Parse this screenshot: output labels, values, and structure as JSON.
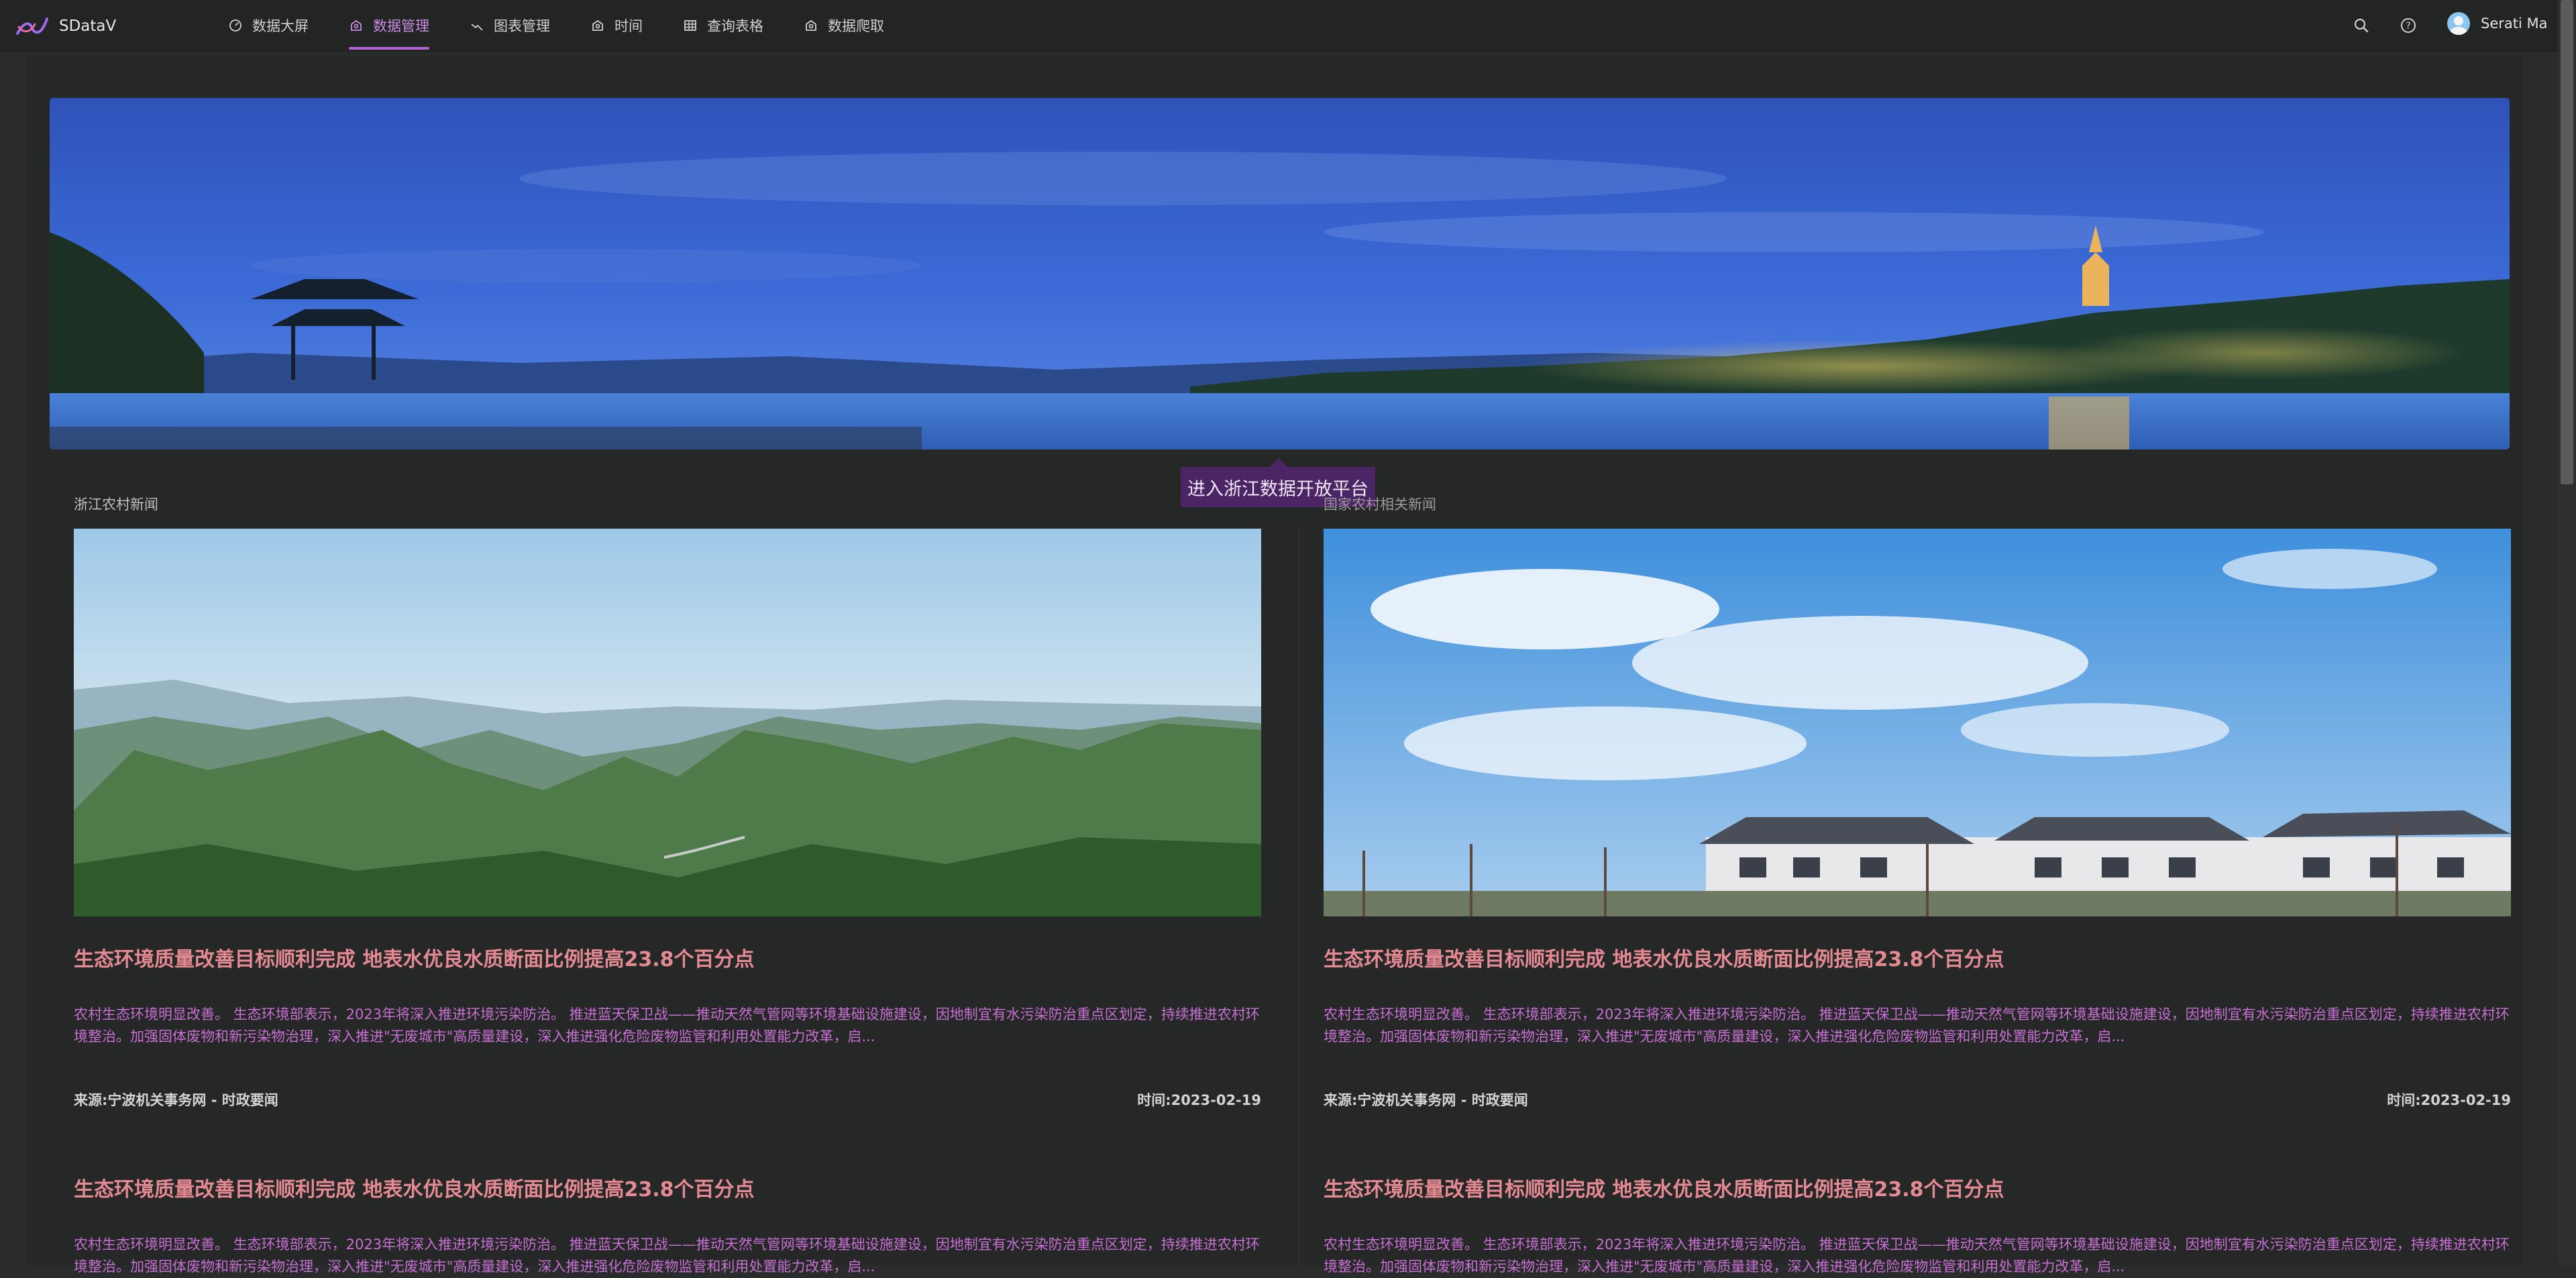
{
  "app": {
    "brand": "SDataV"
  },
  "nav": {
    "items": [
      {
        "label": "数据大屏",
        "icon": "dashboard-icon"
      },
      {
        "label": "数据管理",
        "icon": "data-manage-icon",
        "active": true
      },
      {
        "label": "图表管理",
        "icon": "chart-manage-icon"
      },
      {
        "label": "时间",
        "icon": "time-icon"
      },
      {
        "label": "查询表格",
        "icon": "table-icon"
      },
      {
        "label": "数据爬取",
        "icon": "crawler-icon"
      }
    ],
    "tools": [
      "search-icon",
      "help-icon"
    ],
    "user": "Serati Ma"
  },
  "banner": {
    "tooltip": "进入浙江数据开放平台"
  },
  "columns": [
    {
      "label": "浙江农村新闻",
      "image": "mountain-landscape-image",
      "articles": [
        {
          "title": "生态环境质量改善目标顺利完成 地表水优良水质断面比例提高23.8个百分点",
          "summary": "农村生态环境明显改善。 生态环境部表示，2023年将深入推进环境污染防治。 推进蓝天保卫战——推动天然气管网等环境基础设施建设，因地制宜有水污染防治重点区划定，持续推进农村环境整治。加强固体废物和新污染物治理，深入推进\"无废城市\"高质量建设，深入推进强化危险废物监管和利用处置能力改革，启...",
          "source": "来源:宁波机关事务网  - 时政要闻",
          "time": "时间:2023-02-19"
        },
        {
          "title": "生态环境质量改善目标顺利完成 地表水优良水质断面比例提高23.8个百分点",
          "summary": "农村生态环境明显改善。 生态环境部表示，2023年将深入推进环境污染防治。 推进蓝天保卫战——推动天然气管网等环境基础设施建设，因地制宜有水污染防治重点区划定，持续推进农村环境整治。加强固体废物和新污染物治理，深入推进\"无废城市\"高质量建设，深入推进强化危险废物监管和利用处置能力改革，启..."
        }
      ]
    },
    {
      "label": "国家农村相关新闻",
      "image": "village-houses-sky-image",
      "articles": [
        {
          "title": "生态环境质量改善目标顺利完成 地表水优良水质断面比例提高23.8个百分点",
          "summary": "农村生态环境明显改善。 生态环境部表示，2023年将深入推进环境污染防治。 推进蓝天保卫战——推动天然气管网等环境基础设施建设，因地制宜有水污染防治重点区划定，持续推进农村环境整治。加强固体废物和新污染物治理，深入推进\"无废城市\"高质量建设，深入推进强化危险废物监管和利用处置能力改革，启...",
          "source": "来源:宁波机关事务网  - 时政要闻",
          "time": "时间:2023-02-19"
        },
        {
          "title": "生态环境质量改善目标顺利完成 地表水优良水质断面比例提高23.8个百分点",
          "summary": "农村生态环境明显改善。 生态环境部表示，2023年将深入推进环境污染防治。 推进蓝天保卫战——推动天然气管网等环境基础设施建设，因地制宜有水污染防治重点区划定，持续推进农村环境整治。加强固体废物和新污染物治理，深入推进\"无废城市\"高质量建设，深入推进强化危险废物监管和利用处置能力改革，启..."
        }
      ]
    }
  ],
  "colors": {
    "accent": "#b464d2",
    "title": "#e58a93",
    "summary": "#c86fd3",
    "tooltip_bg": "#4c2565",
    "background": "#2a2c2c"
  }
}
